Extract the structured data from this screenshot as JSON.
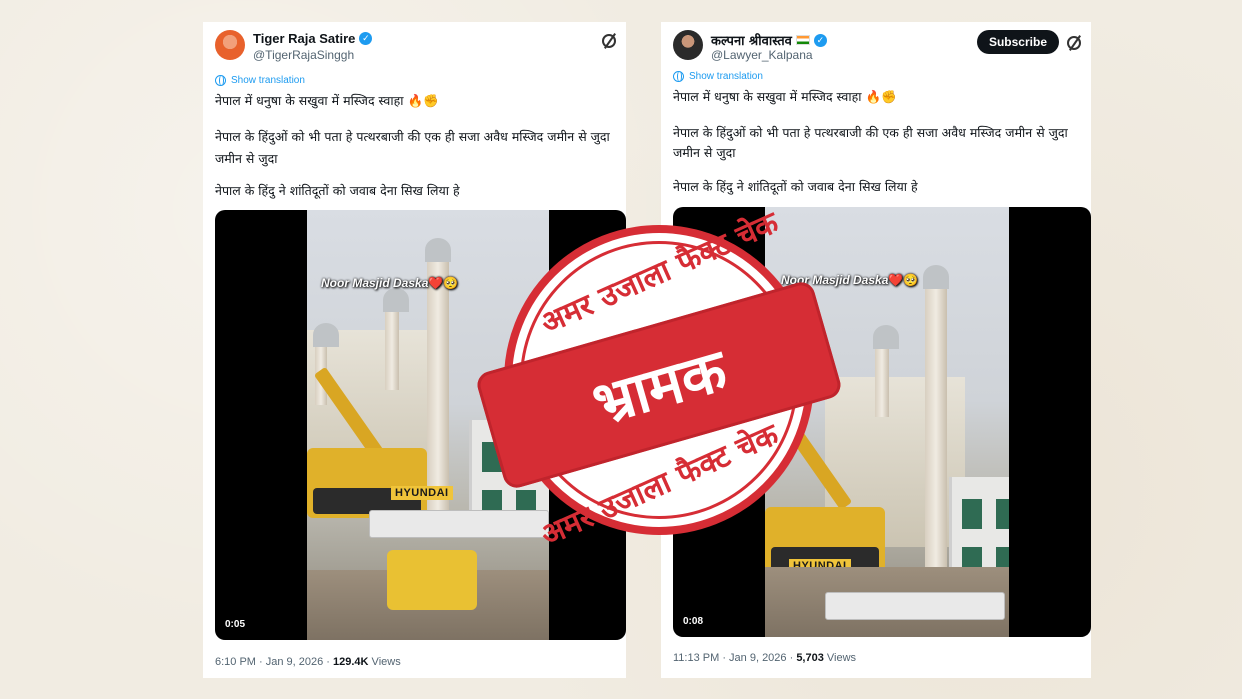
{
  "tweets": [
    {
      "name": "Tiger Raja Satire",
      "handle": "@TigerRajaSinggh",
      "show_translation": "Show translation",
      "text_lines": [
        "नेपाल में धनुषा के सखुवा में मस्जिद स्वाहा 🔥✊",
        "नेपाल के हिंदुओं को भी पता हे पत्थरबाजी की एक ही सजा अवैध मस्जिद जमीन से जुदा",
        "जमीन से जुदा",
        "नेपाल के हिंदु ने शांतिदूतों को जवाब देना सिख लिया हे"
      ],
      "video_caption": "Noor Masjid Daska",
      "caption_emoji": "❤️🥺",
      "video_brand": "HYUNDAI",
      "video_time": "0:05",
      "timestamp": "6:10 PM · Jan 9, 2026 · ",
      "views_count": "129.4K",
      "views_label": " Views"
    },
    {
      "name": "कल्पना श्रीवास्तव",
      "handle": "@Lawyer_Kalpana",
      "subscribe": "Subscribe",
      "show_translation": "Show translation",
      "text_lines": [
        "नेपाल में धनुषा के सखुवा में मस्जिद स्वाहा 🔥✊",
        "नेपाल के हिंदुओं को भी पता हे पत्थरबाजी की एक ही सजा अवैध मस्जिद जमीन से जुदा",
        "जमीन से जुदा",
        "नेपाल के हिंदु ने शांतिदूतों को जवाब देना सिख लिया हे"
      ],
      "video_caption": "Noor Masjid Daska",
      "caption_emoji": "❤️🥺",
      "video_brand": "HYUNDAI",
      "video_time": "0:08",
      "timestamp": "11:13 PM · Jan 9, 2026 · ",
      "views_count": "5,703",
      "views_label": " Views"
    }
  ],
  "stamp": {
    "top_text": "अमर उजाला फैक्ट चेक",
    "banner_text": "भ्रामक",
    "bottom_text": "अमर उजाला फैक्ट चेक",
    "color": "#d62d35"
  },
  "icons": {
    "verified": "verified-badge-icon",
    "grok": "grok-icon",
    "globe": "globe-icon"
  }
}
